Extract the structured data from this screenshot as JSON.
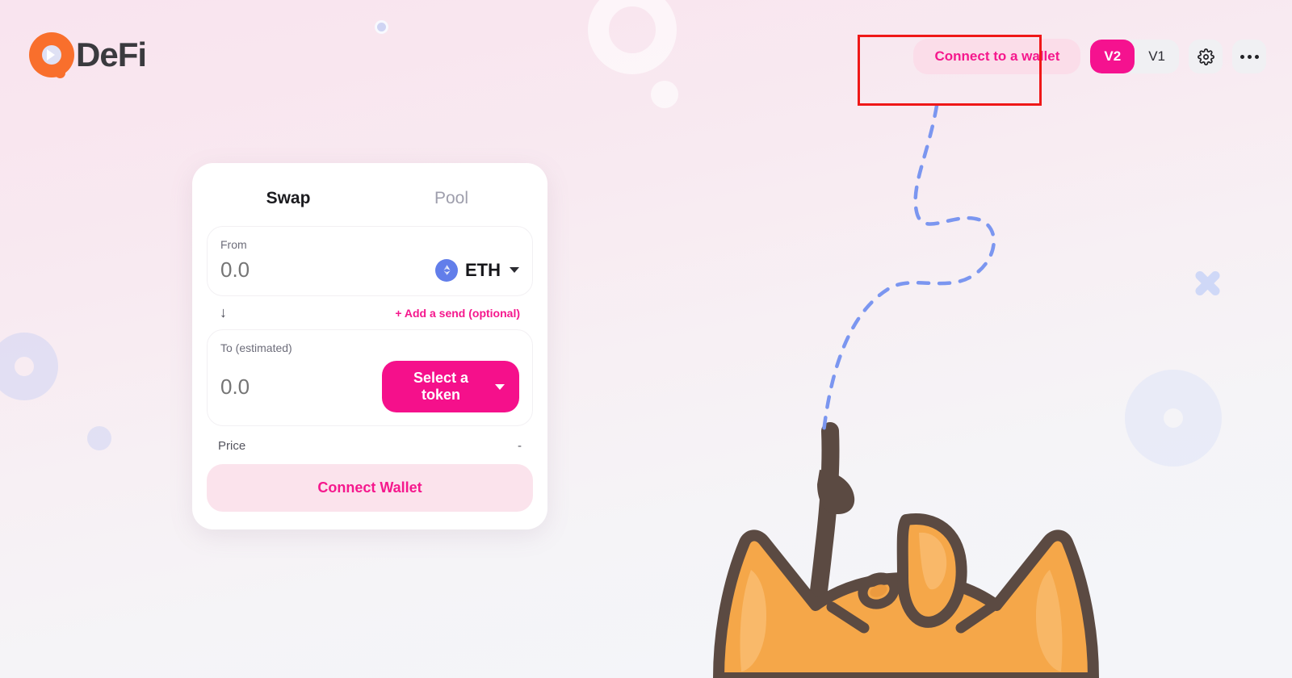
{
  "brand": {
    "logo_icon": "defi-circle-chevron-logo",
    "name": "DeFi"
  },
  "header": {
    "connect_wallet_label": "Connect to a wallet",
    "versions": [
      {
        "label": "V2",
        "active": true
      },
      {
        "label": "V1",
        "active": false
      }
    ],
    "settings_icon": "gear-icon",
    "more_icon": "ellipsis-icon"
  },
  "annotation": {
    "type": "red-highlight-box",
    "target": "Connect to a wallet"
  },
  "swap_card": {
    "tabs": [
      {
        "label": "Swap",
        "active": true
      },
      {
        "label": "Pool",
        "active": false
      }
    ],
    "from": {
      "label": "From",
      "amount_placeholder": "0.0",
      "amount_value": "",
      "token": "ETH",
      "token_icon": "ethereum-icon"
    },
    "middle": {
      "swap_arrow_icon": "arrow-down-icon",
      "add_send_label": "+ Add a send (optional)"
    },
    "to": {
      "label": "To (estimated)",
      "amount_placeholder": "0.0",
      "amount_value": "",
      "select_token_label": "Select a token",
      "chevron_icon": "chevron-down-icon"
    },
    "price": {
      "label": "Price",
      "value": "-"
    },
    "action_label": "Connect Wallet"
  },
  "illustration": {
    "character": "orange-cat-with-fishing-rod",
    "fishing_line": "blue-dashed-looping-line"
  },
  "colors": {
    "accent_pink": "#f5108b",
    "accent_pink_soft": "#fbdde9",
    "eth_blue": "#627eea",
    "annotation_red": "#ef1818",
    "cat_orange": "#f5a749",
    "cat_outline": "#5b4a42",
    "line_blue": "#7b96f0"
  }
}
